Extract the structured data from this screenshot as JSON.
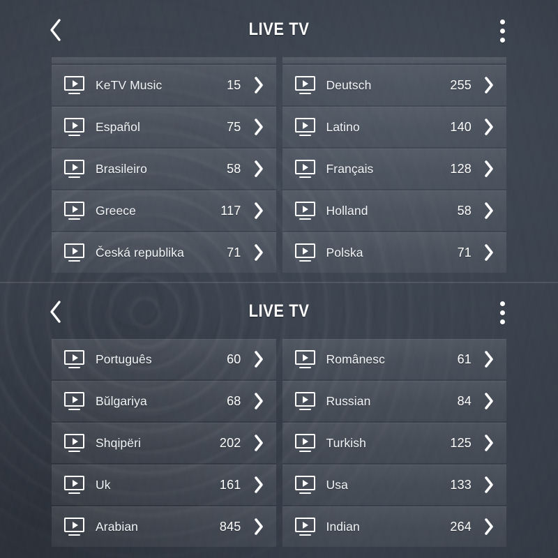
{
  "app": {
    "background_color": "#383f4a",
    "row_color": "#5b6372",
    "accent_text_color": "#ffffff"
  },
  "panels": [
    {
      "header": {
        "title": "LIVE TV",
        "back_icon": "chevron-left-icon",
        "overflow_icon": "more-vertical-icon"
      },
      "rows_left": [
        {
          "icon": "tv-play-icon",
          "label": "KeTV Music",
          "count": "15",
          "chevron": "chevron-right-icon"
        },
        {
          "icon": "tv-play-icon",
          "label": "Español",
          "count": "75",
          "chevron": "chevron-right-icon"
        },
        {
          "icon": "tv-play-icon",
          "label": "Brasileiro",
          "count": "58",
          "chevron": "chevron-right-icon"
        },
        {
          "icon": "tv-play-icon",
          "label": "Greece",
          "count": "117",
          "chevron": "chevron-right-icon"
        },
        {
          "icon": "tv-play-icon",
          "label": "Česká republika",
          "count": "71",
          "chevron": "chevron-right-icon"
        }
      ],
      "rows_right": [
        {
          "icon": "tv-play-icon",
          "label": "Deutsch",
          "count": "255",
          "chevron": "chevron-right-icon"
        },
        {
          "icon": "tv-play-icon",
          "label": "Latino",
          "count": "140",
          "chevron": "chevron-right-icon"
        },
        {
          "icon": "tv-play-icon",
          "label": "Français",
          "count": "128",
          "chevron": "chevron-right-icon"
        },
        {
          "icon": "tv-play-icon",
          "label": "Holland",
          "count": "58",
          "chevron": "chevron-right-icon"
        },
        {
          "icon": "tv-play-icon",
          "label": "Polska",
          "count": "71",
          "chevron": "chevron-right-icon"
        }
      ]
    },
    {
      "header": {
        "title": "LIVE TV",
        "back_icon": "chevron-left-icon",
        "overflow_icon": "more-vertical-icon"
      },
      "rows_left": [
        {
          "icon": "tv-play-icon",
          "label": "Português",
          "count": "60",
          "chevron": "chevron-right-icon"
        },
        {
          "icon": "tv-play-icon",
          "label": "Bŭlgariya",
          "count": "68",
          "chevron": "chevron-right-icon"
        },
        {
          "icon": "tv-play-icon",
          "label": "Shqipëri",
          "count": "202",
          "chevron": "chevron-right-icon"
        },
        {
          "icon": "tv-play-icon",
          "label": "Uk",
          "count": "161",
          "chevron": "chevron-right-icon"
        },
        {
          "icon": "tv-play-icon",
          "label": "Arabian",
          "count": "845",
          "chevron": "chevron-right-icon"
        }
      ],
      "rows_right": [
        {
          "icon": "tv-play-icon",
          "label": "Românesc",
          "count": "61",
          "chevron": "chevron-right-icon"
        },
        {
          "icon": "tv-play-icon",
          "label": "Russian",
          "count": "84",
          "chevron": "chevron-right-icon"
        },
        {
          "icon": "tv-play-icon",
          "label": "Turkish",
          "count": "125",
          "chevron": "chevron-right-icon"
        },
        {
          "icon": "tv-play-icon",
          "label": "Usa",
          "count": "133",
          "chevron": "chevron-right-icon"
        },
        {
          "icon": "tv-play-icon",
          "label": "Indian",
          "count": "264",
          "chevron": "chevron-right-icon"
        }
      ]
    }
  ]
}
